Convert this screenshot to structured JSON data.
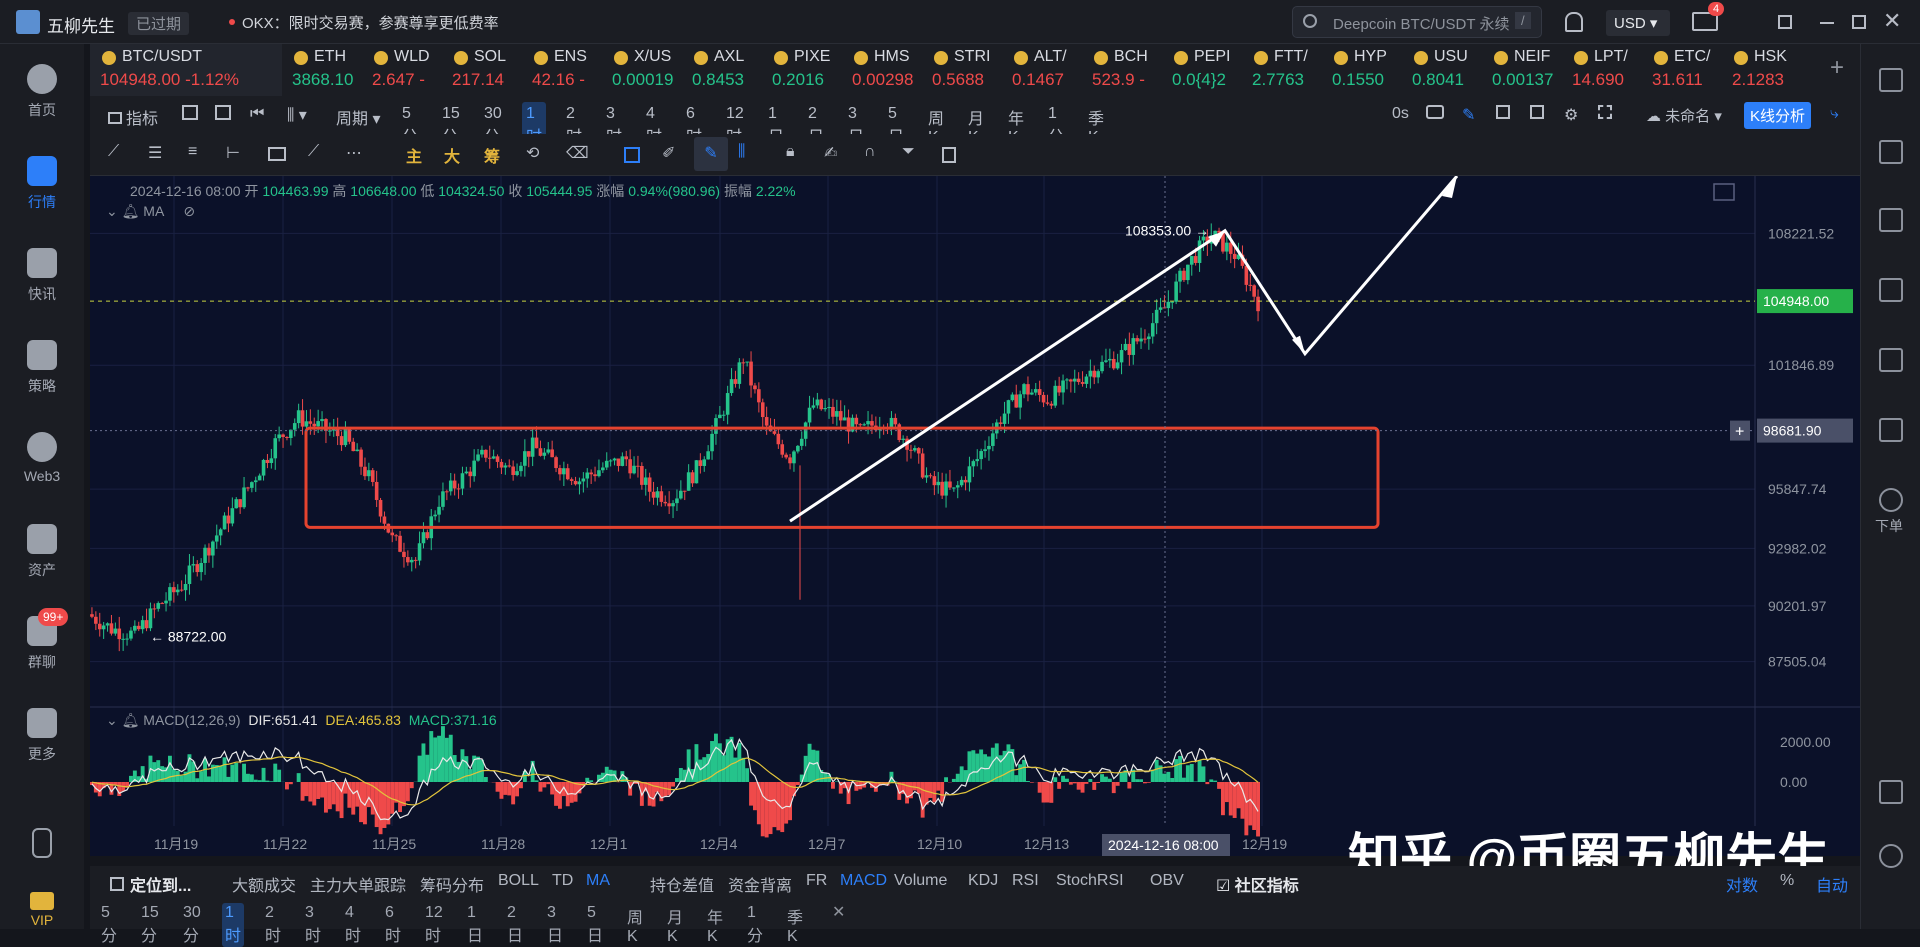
{
  "titlebar": {
    "app_name": "五柳先生",
    "expired_label": "已过期",
    "notice": "OKX：限时交易赛，参赛尊享更低费率",
    "search_placeholder": "Deepcoin BTC/USDT 永续",
    "search_shortcut": "/",
    "currency": "USD",
    "mail_badge": "4"
  },
  "sidebar": {
    "items": [
      {
        "label": "首页"
      },
      {
        "label": "行情"
      },
      {
        "label": "快讯"
      },
      {
        "label": "策略"
      },
      {
        "label": "Web3"
      },
      {
        "label": "资产"
      },
      {
        "label": "群聊"
      },
      {
        "label": "更多"
      },
      {
        "label": "VIP"
      }
    ],
    "chat_badge": "99+"
  },
  "rightbar": {
    "order_label": "下单"
  },
  "tickers": [
    {
      "sym": "BTC/USDT",
      "price": "104948.00",
      "change": "-1.12%",
      "dir": "dn"
    },
    {
      "sym": "ETH",
      "price": "3868.10",
      "dir": "up"
    },
    {
      "sym": "WLD",
      "price": "2.647",
      "change": "-",
      "dir": "dn"
    },
    {
      "sym": "SOL",
      "price": "217.14",
      "dir": "dn"
    },
    {
      "sym": "ENS",
      "price": "42.16",
      "change": "-",
      "dir": "dn"
    },
    {
      "sym": "X/US",
      "price": "0.00019",
      "dir": "up"
    },
    {
      "sym": "AXL",
      "price": "0.8453",
      "dir": "up"
    },
    {
      "sym": "PIXE",
      "price": "0.2016",
      "dir": "up"
    },
    {
      "sym": "HMS",
      "price": "0.00298",
      "dir": "dn"
    },
    {
      "sym": "STRI",
      "price": "0.5688",
      "dir": "dn"
    },
    {
      "sym": "ALT/",
      "price": "0.1467",
      "dir": "dn"
    },
    {
      "sym": "BCH",
      "price": "523.9",
      "change": "-",
      "dir": "dn"
    },
    {
      "sym": "PEPI",
      "price": "0.0{4}2",
      "dir": "up"
    },
    {
      "sym": "FTT/",
      "price": "2.7763",
      "dir": "up"
    },
    {
      "sym": "HYP",
      "price": "0.1550",
      "dir": "up"
    },
    {
      "sym": "USU",
      "price": "0.8041",
      "dir": "up"
    },
    {
      "sym": "NEIF",
      "price": "0.00137",
      "dir": "up"
    },
    {
      "sym": "LPT/",
      "price": "14.690",
      "dir": "dn"
    },
    {
      "sym": "ETC/",
      "price": "31.611",
      "dir": "dn"
    },
    {
      "sym": "HSK",
      "price": "2.1283",
      "dir": "dn"
    }
  ],
  "toolbar": {
    "indicators": "指标",
    "period_label": "周期",
    "intervals": [
      "5分",
      "15分",
      "30分",
      "1时",
      "2时",
      "3时",
      "4时",
      "6时",
      "12时",
      "1日",
      "2日",
      "3日",
      "5日",
      "周K",
      "月K",
      "年K",
      "1分",
      "季K"
    ],
    "active_interval": "1时",
    "countdown": "0s",
    "layout_name": "未命名",
    "kline_analysis": "K线分析"
  },
  "drawtools": {
    "main": "主",
    "big": "大",
    "chip": "筹"
  },
  "ohlc": {
    "date": "2024-12-16 08:00",
    "open_label": "开",
    "open": "104463.99",
    "high_label": "高",
    "high": "106648.00",
    "low_label": "低",
    "low": "104324.50",
    "close_label": "收",
    "close": "105444.95",
    "change_label": "涨幅",
    "change": "0.94%(980.96)",
    "amp_label": "振幅",
    "amp": "2.22%",
    "ma_label": "MA"
  },
  "chart_data": {
    "type": "candlestick",
    "symbol": "BTC/USDT",
    "interval": "1时",
    "y_ticks": [
      "108221.52",
      "101846.89",
      "95847.74",
      "92982.02",
      "90201.97",
      "87505.04"
    ],
    "x_ticks": [
      "11月19",
      "11月22",
      "11月25",
      "11月28",
      "12月1",
      "12月4",
      "12月7",
      "12月10",
      "12月13",
      "12月19"
    ],
    "crosshair_date": "2024-12-16 08:00",
    "last_price": "104948.00",
    "crosshair_price": "98681.90",
    "annotations": {
      "high": "108353.00",
      "low": "88722.00"
    },
    "close_path": [
      89800,
      89100,
      88800,
      90200,
      91200,
      92800,
      94500,
      96200,
      98100,
      99300,
      98800,
      98300,
      96400,
      93400,
      92400,
      95300,
      96400,
      97600,
      96800,
      97900,
      97100,
      96300,
      96900,
      97300,
      95800,
      95400,
      96800,
      99300,
      102200,
      98700,
      97400,
      99900,
      99400,
      98600,
      99300,
      98200,
      96100,
      95700,
      97300,
      99300,
      100700,
      100200,
      100900,
      101700,
      102200,
      103200,
      104600,
      106700,
      108200,
      107200,
      104900
    ],
    "macd": {
      "label": "MACD(12,26,9)",
      "dif": "651.41",
      "dea": "465.83",
      "macd": "371.16",
      "y_ticks": [
        "2000.00",
        "0.00"
      ]
    }
  },
  "bottom": {
    "locate": "定位到...",
    "tabs": [
      "大额成交",
      "主力大单跟踪",
      "筹码分布",
      "BOLL",
      "TD",
      "MA",
      "持仓差值",
      "资金背离",
      "FR",
      "MACD",
      "Volume",
      "KDJ",
      "RSI",
      "StochRSI",
      "OBV"
    ],
    "community": "社区指标",
    "log": "对数",
    "pct": "%",
    "auto": "自动",
    "intervals": [
      "5分",
      "15分",
      "30分",
      "1时",
      "2时",
      "3时",
      "4时",
      "6时",
      "12时",
      "1日",
      "2日",
      "3日",
      "5日",
      "周K",
      "月K",
      "年K",
      "1分",
      "季K"
    ]
  },
  "watermark": "知乎 @币圈五柳先生",
  "colors": {
    "up": "#25c38b",
    "down": "#ef4a4a",
    "accent": "#2d7ff9",
    "box": "#e5432f",
    "price_tag": "#26b14a"
  }
}
